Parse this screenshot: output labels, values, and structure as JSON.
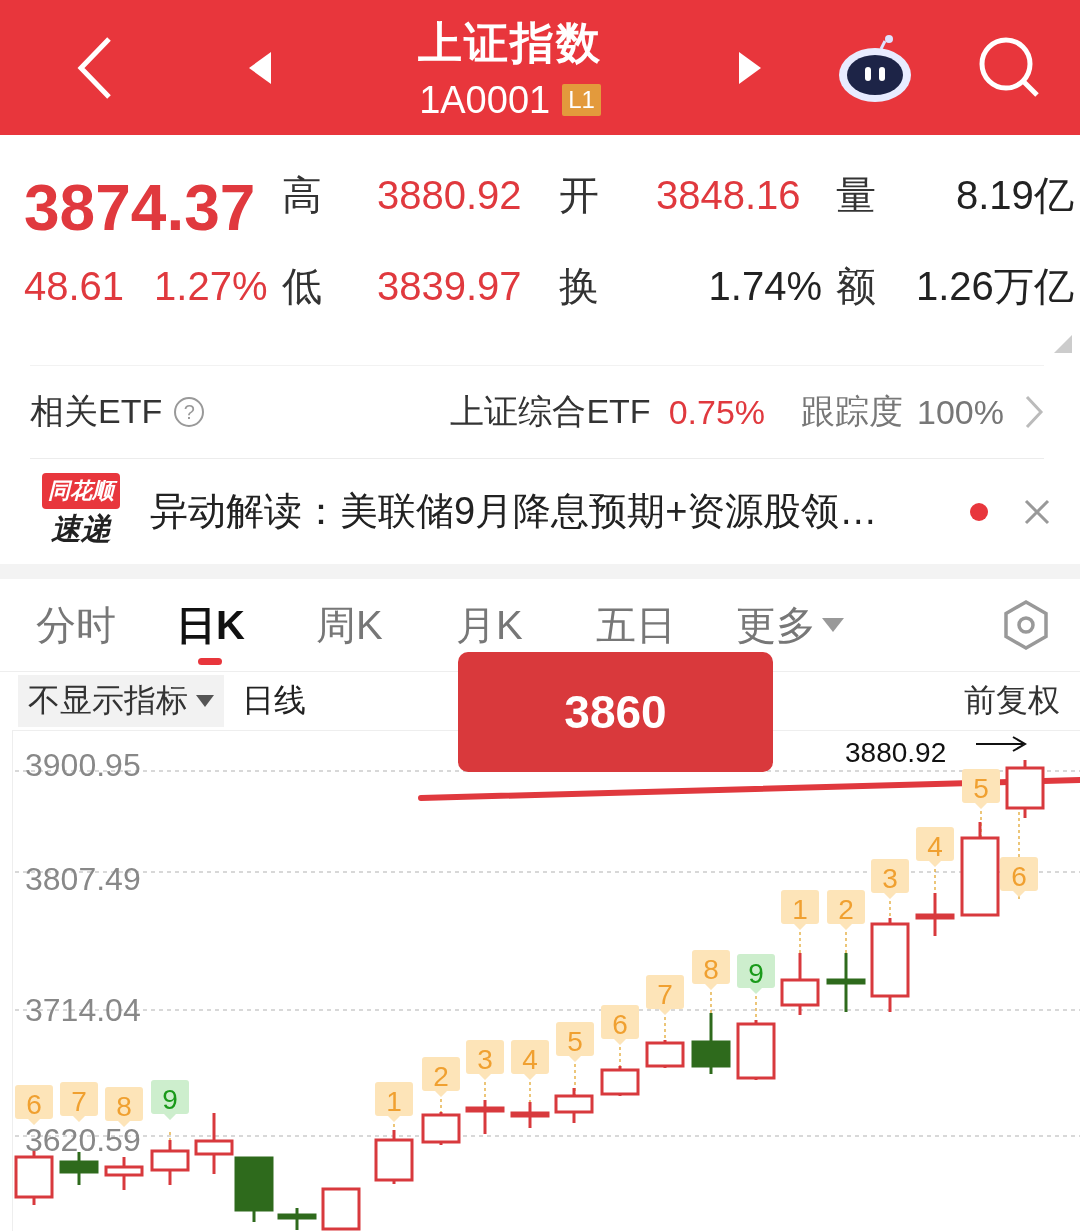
{
  "header": {
    "title": "上证指数",
    "code": "1A0001",
    "level_badge": "L1"
  },
  "quote": {
    "price": "3874.37",
    "change": "48.61",
    "change_pct": "1.27%",
    "stats": [
      {
        "label": "高",
        "value": "3880.92",
        "color": "#e0393e"
      },
      {
        "label": "开",
        "value": "3848.16",
        "color": "#e0393e"
      },
      {
        "label": "量",
        "value": "8.19亿",
        "color": "#222222"
      },
      {
        "label": "低",
        "value": "3839.97",
        "color": "#e0393e"
      },
      {
        "label": "换",
        "value": "1.74%",
        "color": "#222222"
      },
      {
        "label": "额",
        "value": "1.26万亿",
        "color": "#222222"
      }
    ]
  },
  "etf": {
    "label": "相关ETF",
    "help": "?",
    "name": "上证综合ETF",
    "change": "0.75%",
    "tracking_label": "跟踪度",
    "tracking": "100%"
  },
  "news": {
    "logo_top": "同花顺",
    "logo_bottom": "速递",
    "headline": "异动解读：美联储9月降息预期+资源股领…",
    "unread": true
  },
  "tabs": [
    {
      "label": "分时",
      "selected": false
    },
    {
      "label": "日K",
      "selected": true
    },
    {
      "label": "周K",
      "selected": false
    },
    {
      "label": "月K",
      "selected": false
    },
    {
      "label": "五日",
      "selected": false
    },
    {
      "label": "更多",
      "selected": false,
      "dropdown": true
    }
  ],
  "toolbar": {
    "indicator": "不显示指标",
    "period": "日线",
    "adjust": "前复权"
  },
  "overlay_price": "3860",
  "chart": {
    "y_labels": [
      "3900.95",
      "3807.49",
      "3714.04",
      "3620.59"
    ],
    "high_marker": "3880.92",
    "markers": [
      {
        "label": "6",
        "color": "#f0a030"
      },
      {
        "label": "7",
        "color": "#f0a030"
      },
      {
        "label": "8",
        "color": "#f0a030"
      },
      {
        "label": "9",
        "color": "#1a9a1a"
      },
      {
        "label": "1",
        "color": "#f0a030"
      },
      {
        "label": "2",
        "color": "#f0a030"
      },
      {
        "label": "3",
        "color": "#f0a030"
      },
      {
        "label": "4",
        "color": "#f0a030"
      },
      {
        "label": "5",
        "color": "#f0a030"
      },
      {
        "label": "6",
        "color": "#f0a030"
      },
      {
        "label": "7",
        "color": "#f0a030"
      },
      {
        "label": "8",
        "color": "#f0a030"
      },
      {
        "label": "9",
        "color": "#1a9a1a"
      },
      {
        "label": "1",
        "color": "#f0a030"
      },
      {
        "label": "2",
        "color": "#f0a030"
      },
      {
        "label": "3",
        "color": "#f0a030"
      },
      {
        "label": "4",
        "color": "#f0a030"
      },
      {
        "label": "5",
        "color": "#f0a030"
      },
      {
        "label": "6",
        "color": "#f0a030"
      }
    ]
  }
}
